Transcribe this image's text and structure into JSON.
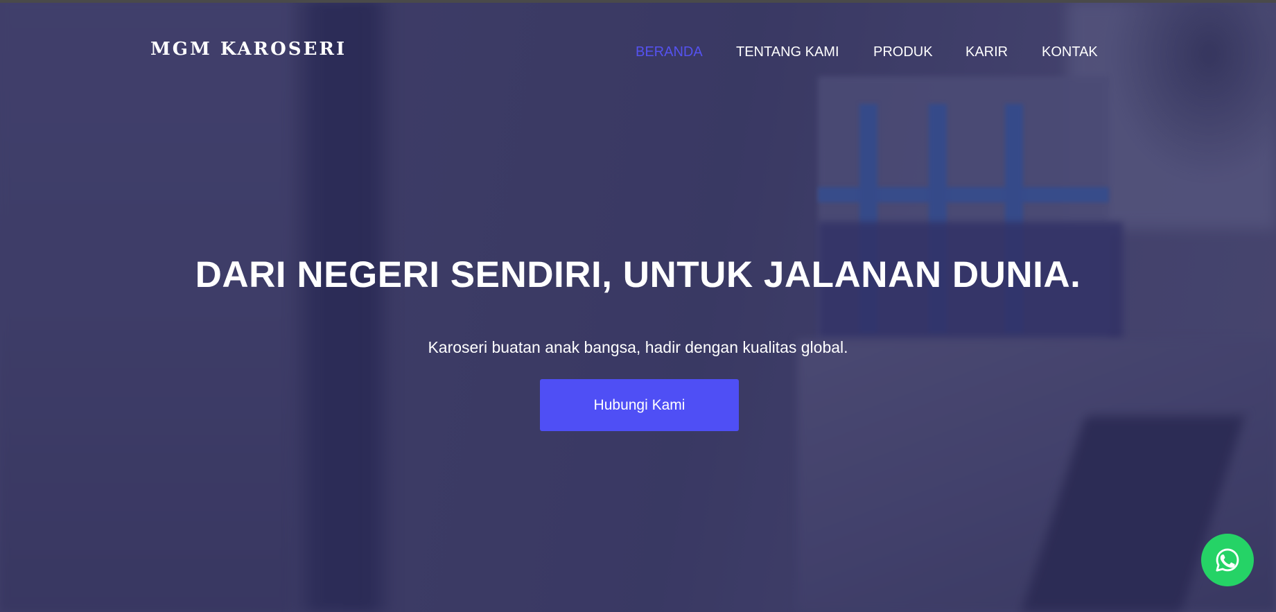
{
  "brand": {
    "logo_text": "MGM KAROSERI"
  },
  "nav": {
    "items": [
      {
        "label": "BERANDA",
        "active": true
      },
      {
        "label": "TENTANG KAMI",
        "active": false
      },
      {
        "label": "PRODUK",
        "active": false
      },
      {
        "label": "KARIR",
        "active": false
      },
      {
        "label": "KONTAK",
        "active": false
      }
    ]
  },
  "hero": {
    "headline": "DARI NEGERI SENDIRI, UNTUK JALANAN DUNIA.",
    "subheadline": "Karoseri buatan anak bangsa, hadir dengan kualitas global.",
    "cta_label": "Hubungi Kami"
  },
  "floating": {
    "icon": "whatsapp-icon"
  },
  "colors": {
    "accent": "#4f4ff5",
    "nav_active": "#5552f0",
    "whatsapp": "#25d366",
    "text": "#ffffff"
  }
}
